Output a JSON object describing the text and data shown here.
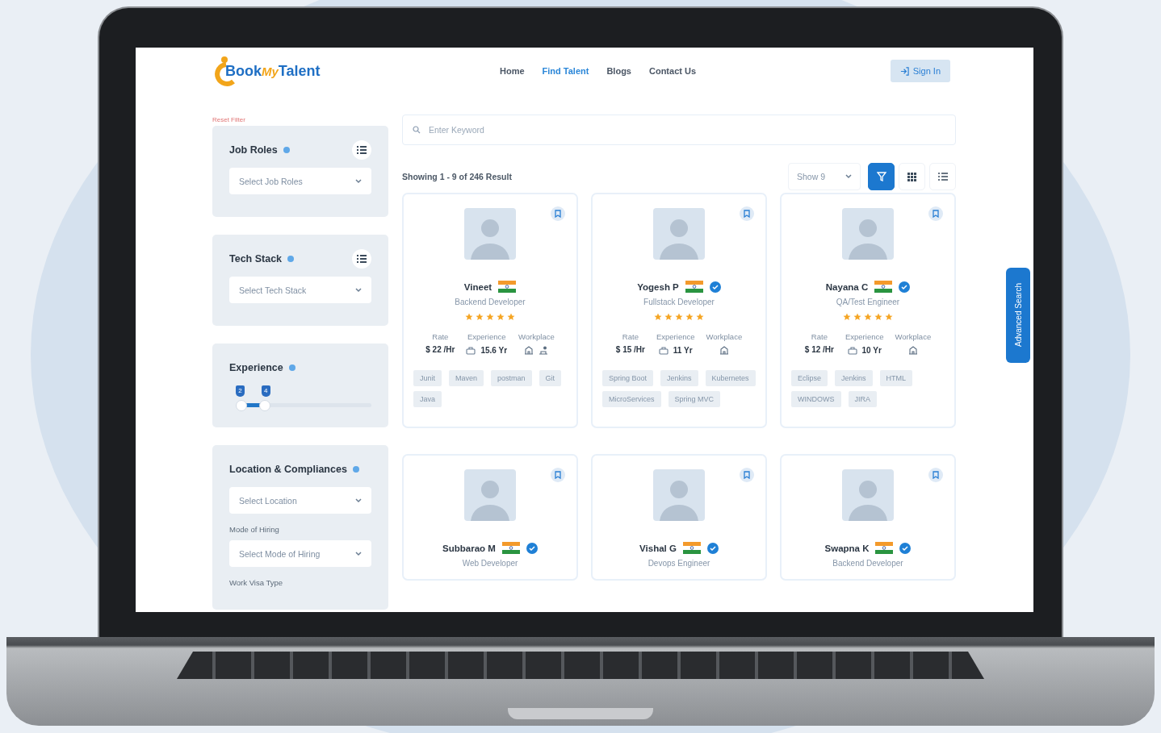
{
  "header": {
    "logo": {
      "first": "Book",
      "middle": "My",
      "last": "Talent"
    },
    "nav": [
      {
        "label": "Home",
        "selected": false
      },
      {
        "label": "Find Talent",
        "selected": true
      },
      {
        "label": "Blogs",
        "selected": false
      },
      {
        "label": "Contact Us",
        "selected": false
      }
    ],
    "sign_in": "Sign In"
  },
  "sidebar": {
    "reset": "Reset Filter",
    "panels": [
      {
        "kind": "select",
        "title": "Job Roles",
        "list_button": true,
        "placeholder": "Select Job Roles"
      },
      {
        "kind": "select",
        "title": "Tech Stack",
        "list_button": true,
        "placeholder": "Select Tech Stack"
      },
      {
        "kind": "range",
        "title": "Experience",
        "low": "2",
        "high": "4",
        "level": 0.18
      },
      {
        "kind": "fields",
        "title": "Location & Compliances",
        "items": [
          {
            "kind": "select",
            "text": "Select Location"
          },
          {
            "kind": "label",
            "text": "Mode of Hiring"
          },
          {
            "kind": "select",
            "text": "Select Mode of Hiring"
          },
          {
            "kind": "label",
            "text": "Work Visa Type"
          }
        ]
      }
    ]
  },
  "main": {
    "search": {
      "placeholder": "Enter Keyword"
    },
    "results": "Showing 1 - 9 of 246 Result",
    "show": "Show 9",
    "view_buttons": [
      {
        "kind": "filter",
        "selected": true
      },
      {
        "kind": "grid",
        "selected": false
      },
      {
        "kind": "list",
        "selected": false
      }
    ],
    "cards": [
      {
        "name": "Vineet",
        "verified": false,
        "role": "Backend Developer",
        "stars": 5,
        "labels": [
          "Rate",
          "Experience",
          "Workplace"
        ],
        "rate": "$ 22 /Hr",
        "experience": "15.6 Yr",
        "workplace": [
          {
            "kind": "office"
          },
          {
            "kind": "remote"
          }
        ],
        "tags": [
          "Junit",
          "Maven",
          "postman",
          "Git",
          "Java"
        ]
      },
      {
        "name": "Yogesh P",
        "verified": true,
        "role": "Fullstack Developer",
        "stars": 5,
        "labels": [
          "Rate",
          "Experience",
          "Workplace"
        ],
        "rate": "$ 15 /Hr",
        "experience": "11 Yr",
        "workplace": [
          {
            "kind": "office"
          }
        ],
        "tags": [
          "Spring Boot",
          "Jenkins",
          "Kubernetes",
          "MicroServices",
          "Spring MVC"
        ]
      },
      {
        "name": "Nayana C",
        "verified": true,
        "role": "QA/Test Engineer",
        "stars": 5,
        "labels": [
          "Rate",
          "Experience",
          "Workplace"
        ],
        "rate": "$ 12 /Hr",
        "experience": "10 Yr",
        "workplace": [
          {
            "kind": "office"
          }
        ],
        "tags": [
          "Eclipse",
          "Jenkins",
          "HTML",
          "WINDOWS",
          "JIRA"
        ]
      },
      {
        "name": "Subbarao M",
        "verified": true,
        "role": "Web Developer"
      },
      {
        "name": "Vishal G",
        "verified": true,
        "role": "Devops Engineer"
      },
      {
        "name": "Swapna K",
        "verified": true,
        "role": "Backend Developer"
      }
    ]
  },
  "advanced_search": "Advanced Search"
}
